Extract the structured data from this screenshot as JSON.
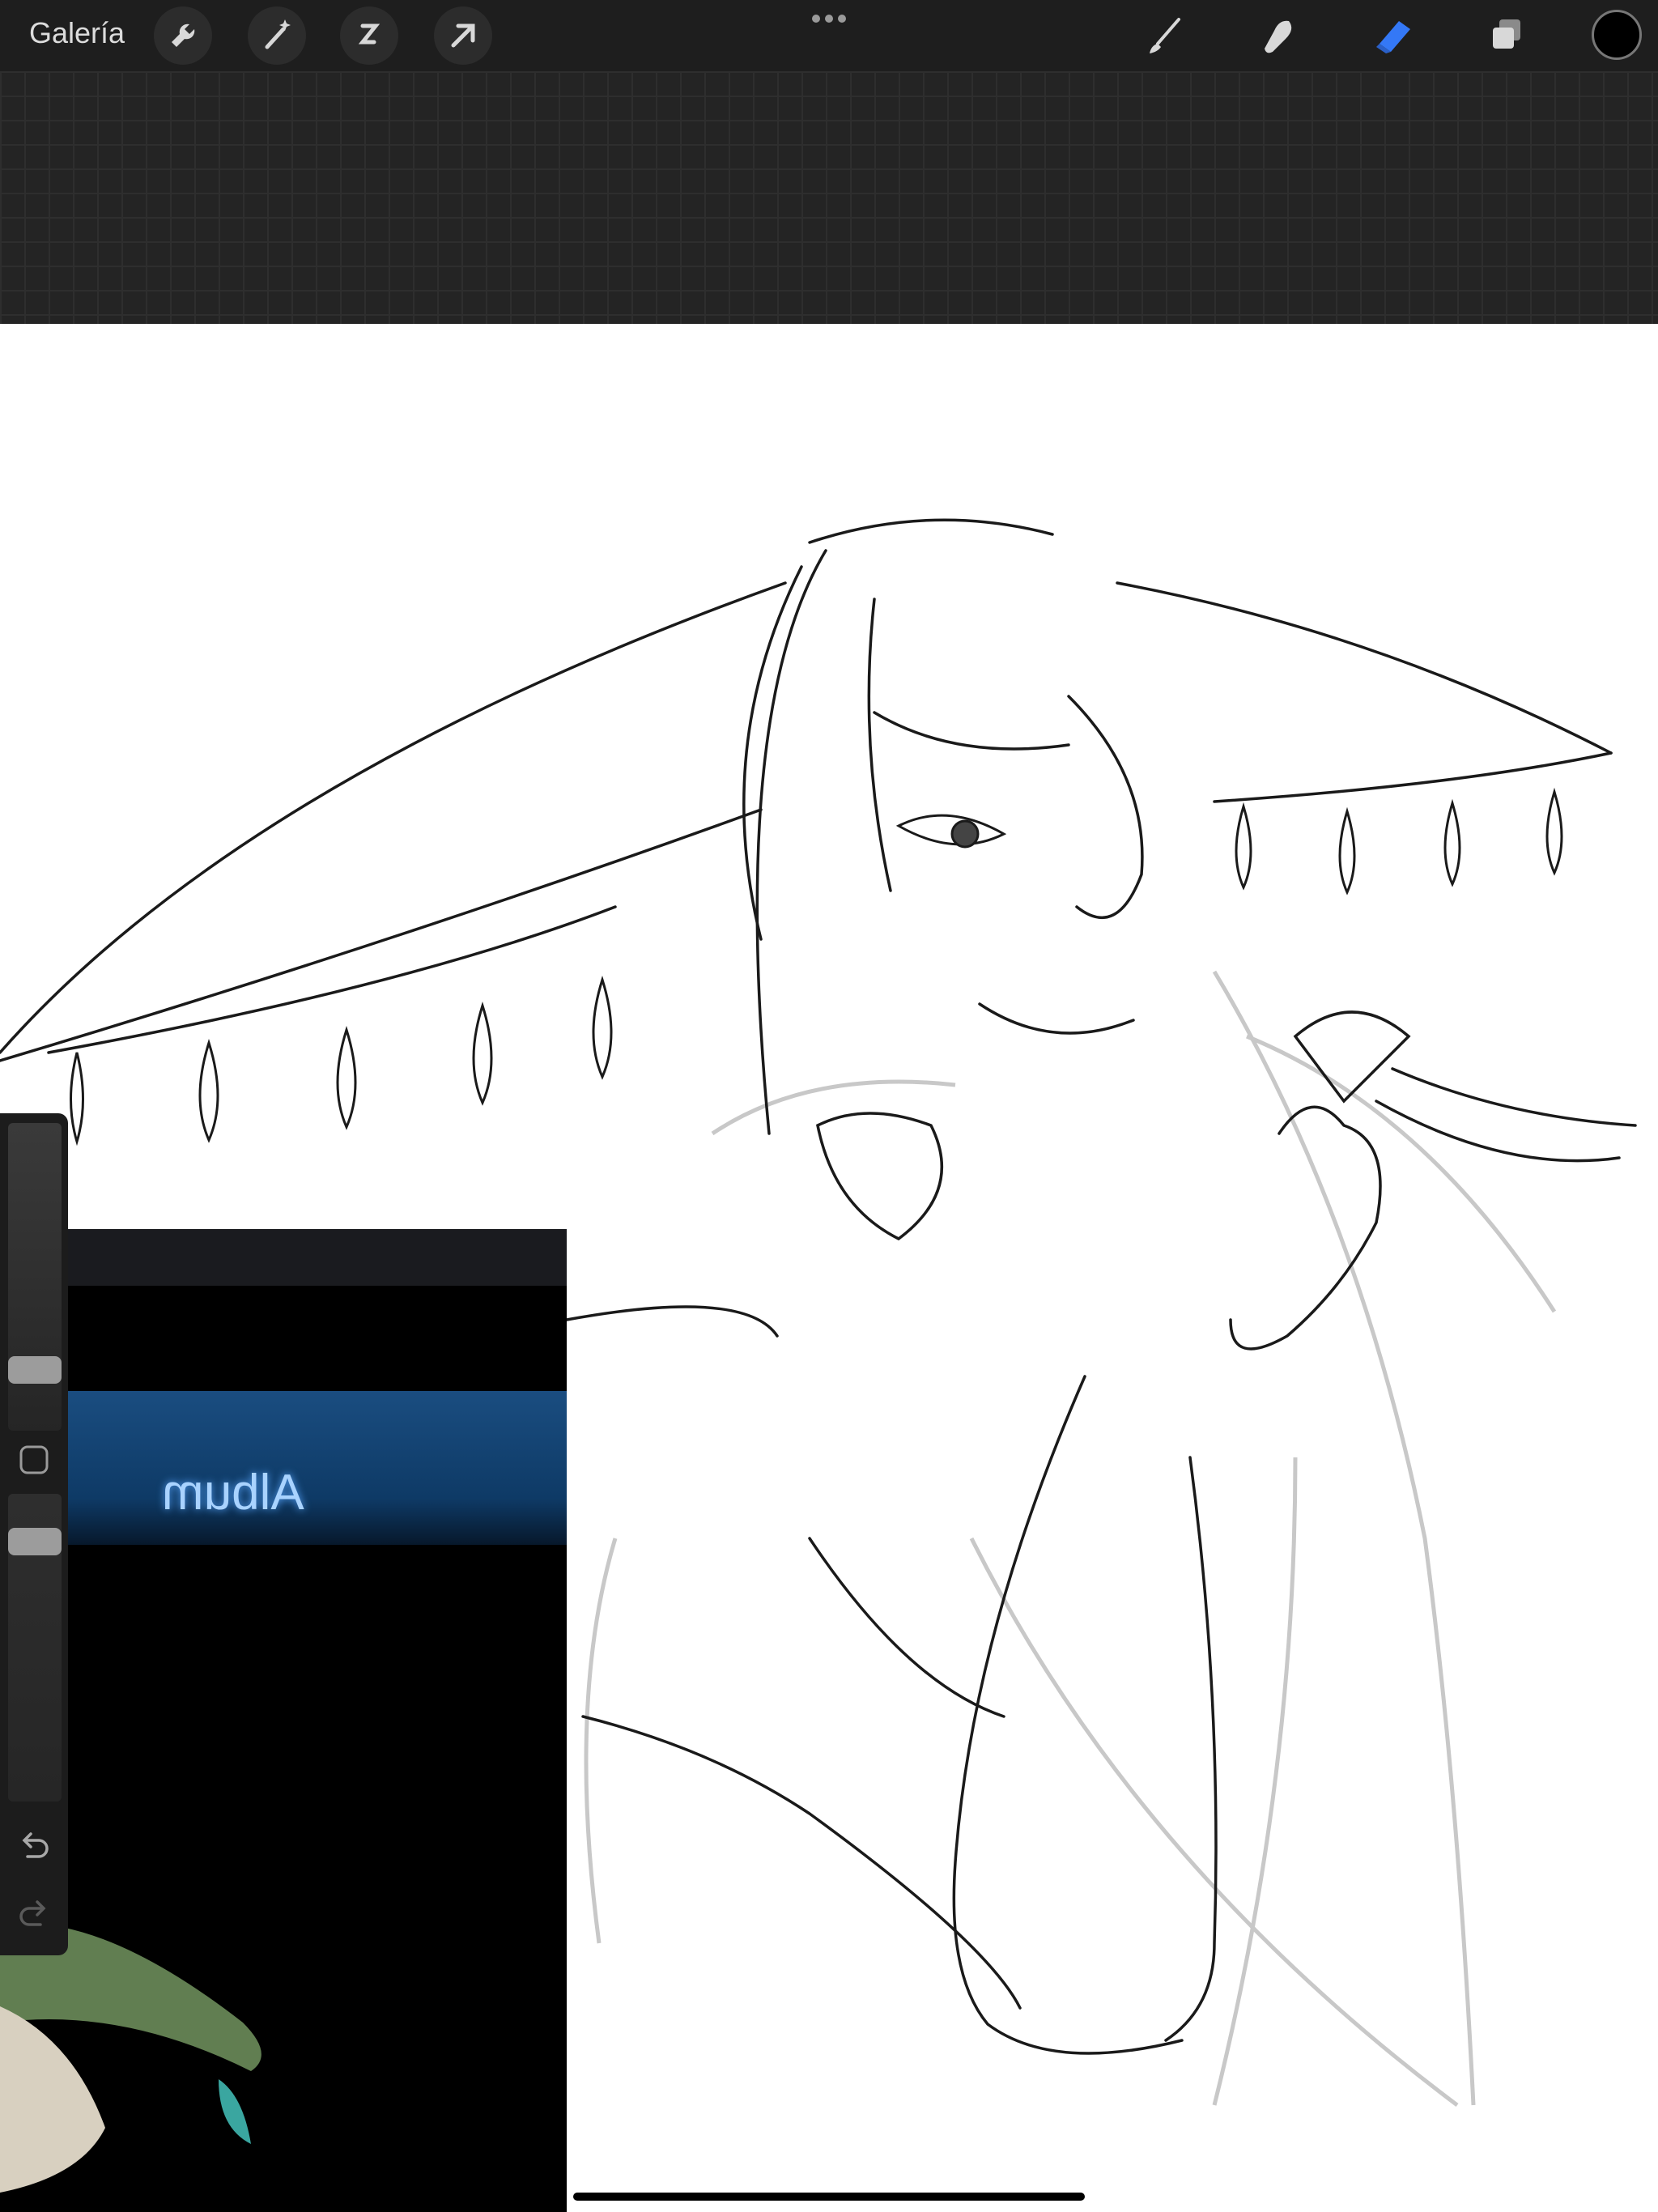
{
  "toolbar": {
    "gallery_label": "Galería",
    "left_tools": [
      "wrench-icon",
      "magic-wand-icon",
      "selection-icon",
      "transform-arrow-icon"
    ],
    "right_tools": [
      "brush-icon",
      "smudge-icon",
      "eraser-icon",
      "layers-icon"
    ],
    "active_tool": "eraser-icon",
    "active_color": "#000000",
    "accent": "#3478f6"
  },
  "reference": {
    "album_label": "Album"
  },
  "sidebar": {
    "undo_icon": "undo-icon",
    "redo_icon": "redo-icon"
  }
}
